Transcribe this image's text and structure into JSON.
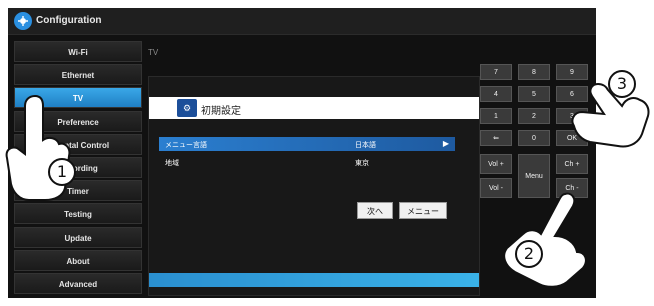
{
  "app": {
    "title": "Configuration"
  },
  "sidebar": {
    "items": [
      {
        "label": "Wi-Fi"
      },
      {
        "label": "Ethernet"
      },
      {
        "label": "TV"
      },
      {
        "label": "Preference"
      },
      {
        "label": "Parental Control"
      },
      {
        "label": "Recording"
      },
      {
        "label": "Timer"
      },
      {
        "label": "Testing"
      },
      {
        "label": "Update"
      },
      {
        "label": "About"
      },
      {
        "label": "Advanced"
      }
    ],
    "active_index": 2
  },
  "content": {
    "header": "TV"
  },
  "dialog": {
    "title": "初期設定",
    "rows": [
      {
        "label": "メニュー言語",
        "value": "日本語"
      },
      {
        "label": "地域",
        "value": "東京"
      }
    ],
    "next_label": "次へ",
    "menu_label": "メニュー"
  },
  "keypad": {
    "keys": [
      "7",
      "8",
      "9",
      "4",
      "5",
      "6",
      "1",
      "2",
      "3",
      "⇐",
      "0",
      "OK",
      "Vol +",
      "Menu",
      "Ch +",
      "Vol -",
      "Ch -"
    ]
  },
  "annotations": {
    "step1": "1",
    "step2": "2",
    "step3": "3"
  },
  "colors": {
    "accent": "#2a8fe0",
    "active_item": "#2a97d8",
    "background": "#111111"
  }
}
